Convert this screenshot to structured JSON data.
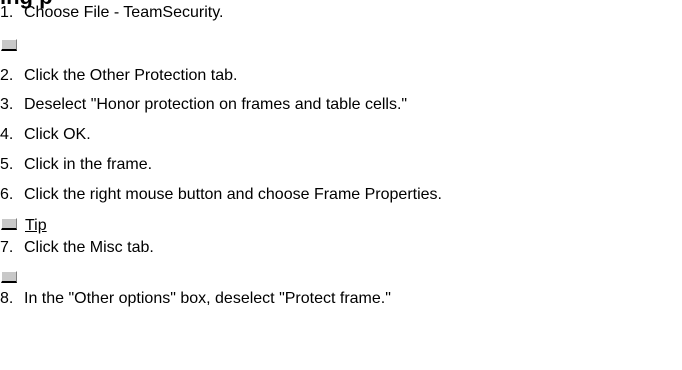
{
  "heading_fragment": "ing p",
  "steps": [
    {
      "num": "1.",
      "text": "Choose File - TeamSecurity."
    },
    {
      "num": "2.",
      "text": "Click the Other Protection tab."
    },
    {
      "num": "3.",
      "text": "Deselect \"Honor protection on frames and table cells.\""
    },
    {
      "num": "4.",
      "text": "Click OK."
    },
    {
      "num": "5.",
      "text": "Click in the frame."
    },
    {
      "num": "6.",
      "text": "Click the right mouse button and choose Frame Properties."
    },
    {
      "num": "7.",
      "text": "Click the Misc tab."
    },
    {
      "num": "8.",
      "text": "In the \"Other options\" box, deselect \"Protect frame.\""
    }
  ],
  "tip_label": "Tip",
  "icons": {
    "screenshot_chip": "screenshot-thumbnail-icon"
  }
}
